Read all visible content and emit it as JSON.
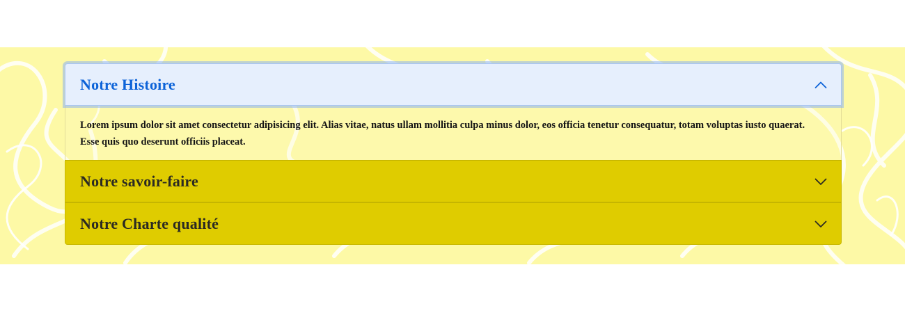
{
  "accordion": {
    "items": [
      {
        "title": "Notre Histoire",
        "expanded": true,
        "body": "Lorem ipsum dolor sit amet consectetur adipisicing elit. Alias vitae, natus ullam mollitia culpa minus dolor, eos officia tenetur consequatur, totam voluptas iusto quaerat. Esse quis quo deserunt officiis placeat.",
        "icon": "chevron-up-icon"
      },
      {
        "title": "Notre savoir-faire",
        "expanded": false,
        "icon": "chevron-down-icon"
      },
      {
        "title": "Notre Charte qualité",
        "expanded": false,
        "icon": "chevron-down-icon"
      }
    ]
  },
  "colors": {
    "band_background": "#fdf9a6",
    "active_header_bg": "#e6effd",
    "active_header_text": "#0d63d8",
    "closed_header_bg": "#dfcc00",
    "closed_header_text": "#2b2a22"
  }
}
